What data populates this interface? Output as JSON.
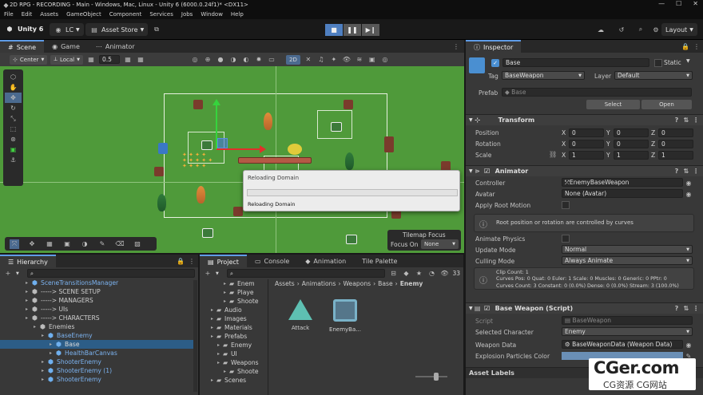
{
  "title": "2D RPG - RECORDING - Main - Windows, Mac, Linux - Unity 6 (6000.0.24f1)* <DX11>",
  "menu": [
    "File",
    "Edit",
    "Assets",
    "GameObject",
    "Component",
    "Services",
    "Jobs",
    "Window",
    "Help"
  ],
  "toolbar": {
    "brand": "Unity 6",
    "account": "LC",
    "asset_store": "Asset Store",
    "layout": "Layout"
  },
  "scene_tabs": [
    "Scene",
    "Game",
    "Animator"
  ],
  "scene_toolbar": {
    "pivot": "Center",
    "space": "Local",
    "snap": "0.5",
    "mode2d": "2D"
  },
  "reload": {
    "title": "Reloading Domain",
    "status": "Reloading Domain"
  },
  "tilemap_focus": {
    "title": "Tilemap Focus",
    "label": "Focus On",
    "value": "None"
  },
  "bottom_tabs": {
    "hierarchy": "Hierarchy",
    "project": "Project",
    "console": "Console",
    "animation": "Animation",
    "tile_palette": "Tile Palette"
  },
  "hierarchy": [
    {
      "label": "SceneTransitionsManager",
      "indent": 0,
      "color": "#7cb3f0"
    },
    {
      "label": "-----> SCENE SETUP",
      "indent": 0,
      "color": "#cfcfcf"
    },
    {
      "label": "-----> MANAGERS",
      "indent": 0,
      "color": "#cfcfcf"
    },
    {
      "label": "-----> UIs",
      "indent": 0,
      "color": "#cfcfcf"
    },
    {
      "label": "-----> CHARACTERS",
      "indent": 0,
      "color": "#cfcfcf"
    },
    {
      "label": "Enemies",
      "indent": 1,
      "color": "#cfcfcf"
    },
    {
      "label": "BaseEnemy",
      "indent": 2,
      "color": "#7cb3f0"
    },
    {
      "label": "Base",
      "indent": 3,
      "color": "#dcdcdc",
      "selected": true
    },
    {
      "label": "HealthBarCanvas",
      "indent": 3,
      "color": "#7cb3f0"
    },
    {
      "label": "ShooterEnemy",
      "indent": 2,
      "color": "#7cb3f0"
    },
    {
      "label": "ShooterEnemy (1)",
      "indent": 2,
      "color": "#7cb3f0"
    },
    {
      "label": "ShooterEnemy",
      "indent": 2,
      "color": "#7cb3f0"
    }
  ],
  "project": {
    "search_count": "33",
    "breadcrumb": [
      "Assets",
      "Animations",
      "Weapons",
      "Base",
      "Enemy"
    ],
    "tree": [
      {
        "label": "Enem",
        "indent": 3
      },
      {
        "label": "Playe",
        "indent": 3
      },
      {
        "label": "Shoote",
        "indent": 3
      },
      {
        "label": "Audio",
        "indent": 1
      },
      {
        "label": "Images",
        "indent": 1
      },
      {
        "label": "Materials",
        "indent": 1
      },
      {
        "label": "Prefabs",
        "indent": 1
      },
      {
        "label": "Enemy",
        "indent": 2
      },
      {
        "label": "UI",
        "indent": 2
      },
      {
        "label": "Weapons",
        "indent": 2
      },
      {
        "label": "Shoote",
        "indent": 3
      },
      {
        "label": "Scenes",
        "indent": 1
      }
    ],
    "assets": [
      {
        "label": "Attack",
        "icon": "animation-clip-icon"
      },
      {
        "label": "EnemyBa...",
        "icon": "animator-controller-icon"
      }
    ]
  },
  "inspector": {
    "tab": "Inspector",
    "name": "Base",
    "static": "Static",
    "tag_label": "Tag",
    "tag": "BaseWeapon",
    "layer_label": "Layer",
    "layer": "Default",
    "prefab_label": "Prefab",
    "prefab": "Base",
    "select": "Select",
    "open": "Open",
    "transform": {
      "title": "Transform",
      "position": [
        "0",
        "0",
        "0"
      ],
      "rotation": [
        "0",
        "0",
        "0"
      ],
      "scale": [
        "1",
        "1",
        "1"
      ],
      "labels": [
        "Position",
        "Rotation",
        "Scale"
      ]
    },
    "animator": {
      "title": "Animator",
      "controller_label": "Controller",
      "controller": "EnemyBaseWeapon",
      "avatar_label": "Avatar",
      "avatar": "None (Avatar)",
      "root_motion": "Apply Root Motion",
      "info": "Root position or rotation are controlled by curves",
      "physics": "Animate Physics",
      "update_label": "Update Mode",
      "update": "Normal",
      "culling_label": "Culling Mode",
      "culling": "Always Animate",
      "clip_info": [
        "Clip Count: 1",
        "Curves Pos: 0 Quat: 0 Euler: 1 Scale: 0 Muscles: 0 Generic: 0 PPtr: 0",
        "Curves Count: 3 Constant: 0 (0.0%) Dense: 0 (0.0%) Stream: 3 (100.0%)"
      ]
    },
    "script": {
      "title": "Base Weapon (Script)",
      "script_label": "Script",
      "script": "BaseWeapon",
      "char_label": "Selected Character",
      "char": "Enemy",
      "data_label": "Weapon Data",
      "data": "BaseWeaponData (Weapon Data)",
      "color_label": "Explosion Particles Color"
    },
    "asset_labels": "Asset Labels"
  },
  "watermark": {
    "main": "CGer.com",
    "sub": "CG资源 CG网站"
  }
}
